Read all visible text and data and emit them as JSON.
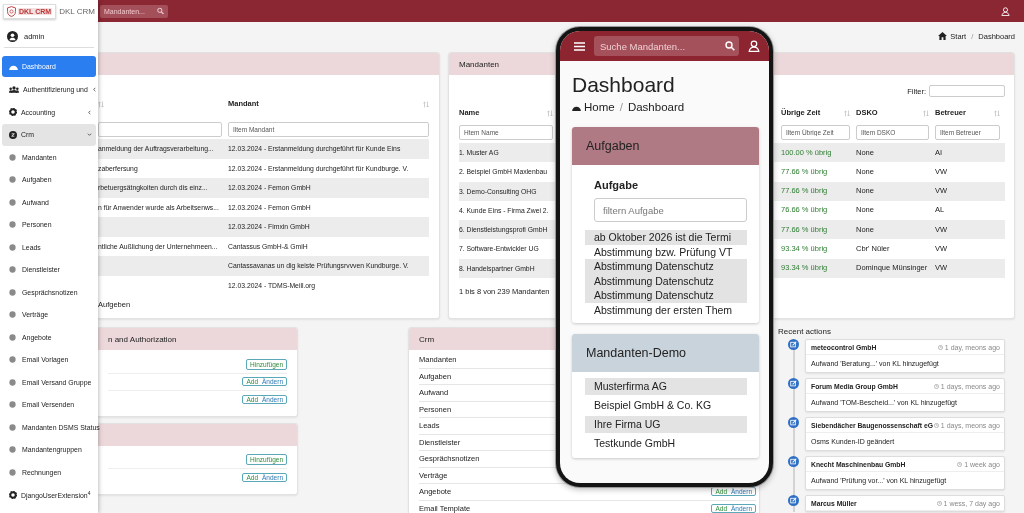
{
  "sidebar": {
    "logo_text": "DKL CRM",
    "brand": "DKL CRM",
    "user": "admin",
    "items": [
      {
        "label": "Dashboard",
        "kind": "dashboard",
        "selected": true
      },
      {
        "label": "Authentifizierung und",
        "kind": "users",
        "selected": false,
        "expanded": false
      },
      {
        "label": "Accounting",
        "kind": "gear",
        "selected": false,
        "expanded": false
      },
      {
        "label": "Crm",
        "kind": "module",
        "selected": false,
        "expanded": true,
        "children": [
          {
            "label": "Mandanten",
            "selected": false
          },
          {
            "label": "Aufgaben",
            "selected": false
          },
          {
            "label": "Aufwand",
            "selected": false
          },
          {
            "label": "Personen",
            "selected": false
          },
          {
            "label": "Leads",
            "selected": false
          },
          {
            "label": "Dienstleister",
            "selected": false
          },
          {
            "label": "Gesprächsnotizen",
            "selected": false
          },
          {
            "label": "Verträge",
            "selected": false
          },
          {
            "label": "Angebote",
            "selected": false
          },
          {
            "label": "Email Vorlagen",
            "selected": false
          },
          {
            "label": "Email Versand Gruppe",
            "selected": false
          },
          {
            "label": "Email Versenden",
            "selected": false
          },
          {
            "label": "Mandanten DSMS Status",
            "selected": false
          },
          {
            "label": "Mandantengruppen",
            "selected": false
          },
          {
            "label": "Rechnungen",
            "selected": false
          }
        ]
      },
      {
        "label": "DjangoUserExtension$^{4}$",
        "kind": "gear",
        "selected": false
      }
    ]
  },
  "header": {
    "search_placeholder": "Mandanten..."
  },
  "breadcrumb": {
    "separator": "/",
    "items": [
      "Start",
      "Dashboard"
    ]
  },
  "tasks_panel": {
    "mandant_heading": "Mandant",
    "mandant_filter_placeholder": "Iltem Mandant",
    "rows": [
      {
        "column_1": "anmeldung der Auftragsverarbeitung...",
        "mandant": "12.03.2024 - Erstanmeldung durchgeführt für Kunde Eins"
      },
      {
        "column_1": "zaberfersung",
        "mandant": "12.03.2024 - Erstanmeldung durchgeführt für Kundburge. V."
      },
      {
        "column_1": "rbetuergsätngkoiten durch dis einz...",
        "mandant": "12.03.2024 - Femon GmbH"
      },
      {
        "column_1": "n für Anwender wurde als Arbeitsenws...",
        "mandant": "12.03.2024 - Femon GmbH"
      },
      {
        "mandant": "12.03.2024 - Fimxin GmbH"
      },
      {
        "column_1": "ntliche Außlichung der Unternehmeen...",
        "mandant": "Cantassus GmbH-& GmiH"
      },
      {
        "mandant": "Cantassavanas un dig keiste Prüfungsrvvven Kundburge. V."
      },
      {
        "mandant": "12.03.2024 - TDMS-Meill.org"
      }
    ],
    "footer": "Aufgeben"
  },
  "mandanten_panel": {
    "title": "Mandanten",
    "filter_label": "Filter:",
    "columns": [
      {
        "label": "Name",
        "placeholder": "Htem Name"
      },
      {
        "label": "Übrige Zeit",
        "placeholder": "Iltem Übrige Zeit"
      },
      {
        "label": "DSKO",
        "placeholder": "Iltem DSKO"
      },
      {
        "label": "Betreuer",
        "placeholder": "Iltem Betreuer"
      }
    ],
    "rows": [
      {
        "name": "1. Muster AG",
        "remaining": "100.00 % übrig",
        "dsko": "None",
        "betreuer": "AI"
      },
      {
        "name": "2. Beispiel GmbH Maxlenbau",
        "remaining": "77.66 % übrig",
        "dsko": "None",
        "betreuer": "VW"
      },
      {
        "name": "3. Demo-Consulting OHG",
        "remaining": "77.66 % übrig",
        "dsko": "None",
        "betreuer": "VW"
      },
      {
        "name": "4. Kunde Eins - Firma Zwei 2.",
        "remaining": "76.66 % übrig",
        "dsko": "None",
        "betreuer": "AL"
      },
      {
        "name": "6. Dienstleistungsprofi GmbH",
        "remaining": "77.66 % übrig",
        "dsko": "None",
        "betreuer": "VW"
      },
      {
        "name": "7. Software-Entwickler UG",
        "remaining": "93.34 % übrig",
        "dsko": "Cbr' Nüler",
        "betreuer": "VW"
      },
      {
        "name": "8. Handelspartner GmbH",
        "remaining": "93.34 % übrig",
        "dsko": "Dominque Münsinger",
        "betreuer": "VW"
      }
    ],
    "footer": "1 bis 8 von 239 Mandanten"
  },
  "auth_panels": [
    {
      "title": "n and Authorization",
      "rows": [
        {
          "actions": [
            {
              "label": "Hinzufügen",
              "kind": "add"
            }
          ]
        },
        {
          "actions": [
            {
              "label": "Add",
              "kind": "add"
            },
            {
              "label": "Ändern",
              "kind": "change"
            }
          ]
        },
        {
          "actions": [
            {
              "label": "Add",
              "kind": "add"
            },
            {
              "label": "Ändern",
              "kind": "change"
            }
          ]
        }
      ]
    },
    {
      "rows": [
        {
          "actions": [
            {
              "label": "Hinzufügen",
              "kind": "add"
            }
          ]
        },
        {
          "actions": [
            {
              "label": "Add",
              "kind": "add"
            },
            {
              "label": "Ändern",
              "kind": "change"
            }
          ]
        }
      ]
    }
  ],
  "crm_panel": {
    "title": "Crm",
    "items": [
      {
        "label": "Mandanten"
      },
      {
        "label": "Aufgaben"
      },
      {
        "label": "Aufwand"
      },
      {
        "label": "Personen"
      },
      {
        "label": "Leads"
      },
      {
        "label": "Dienstleister"
      },
      {
        "label": "Gesprächsnotizen"
      },
      {
        "label": "Verträge"
      },
      {
        "label": "Angebote",
        "actions": [
          {
            "label": "Add",
            "kind": "add"
          },
          {
            "label": "Ändern",
            "kind": "change"
          }
        ]
      },
      {
        "label": "Email Template",
        "actions": [
          {
            "label": "Add",
            "kind": "add"
          },
          {
            "label": "Ändern",
            "kind": "change"
          }
        ]
      }
    ]
  },
  "recent_actions": {
    "title": "Recent actions",
    "items": [
      {
        "title": "meteocontrol GmbH",
        "time": "1 day, meons ago",
        "text": "Aufwand 'Beratung...' von KL hinzugefügt"
      },
      {
        "title": "Forum Media Group GmbH",
        "time": "1 days, meons ago",
        "text": "Aufwand 'TOM-Bescheid...' von KL hinzugefügt"
      },
      {
        "title": "Siebendächer Baugenossenschaft eG",
        "time": "1 days, meons ago",
        "text": "Osms Kunden-ID geändert"
      },
      {
        "title": "Knecht Maschinenbau GmbH",
        "time": "1 week ago",
        "text": "Aufwand 'Prüfung vor...' von KL hinzugefügt"
      },
      {
        "title": "Marcus Müller",
        "time": "1 wess, 7 day ago"
      }
    ]
  },
  "phone": {
    "search_placeholder": "Suche Mandanten...",
    "title": "Dashboard",
    "breadcrumb": {
      "separator": "/",
      "items": [
        "Home",
        "Dashboard"
      ]
    },
    "cards": [
      {
        "title": "Aufgaben",
        "kind": "table",
        "color": "#b07a84",
        "column": "Aufgabe",
        "placeholder": "filtern Aufgabe",
        "rows": [
          {
            "text": "ab Oktober 2026 ist die Termi",
            "shaded": true
          },
          {
            "text": "Abstimmung bzw. Prüfung VT",
            "shaded": false
          },
          {
            "text": "Abstimmung Datenschutz",
            "shaded": true
          },
          {
            "text": "Abstimmung Datenschutz",
            "shaded": true
          },
          {
            "text": "Abstimmung Datenschutz",
            "shaded": true
          },
          {
            "text": "Abstimmung der ersten Them",
            "shaded": false
          }
        ]
      },
      {
        "title": "Mandanten-Demo",
        "kind": "list",
        "color": "#c9d3dc",
        "rows": [
          {
            "text": "Musterfirma AG",
            "shaded": true
          },
          {
            "text": "Beispiel GmbH & Co. KG",
            "shaded": false
          },
          {
            "text": "Ihre Firma UG",
            "shaded": true
          },
          {
            "text": "Testkunde GmbH",
            "shaded": false
          }
        ]
      }
    ]
  }
}
